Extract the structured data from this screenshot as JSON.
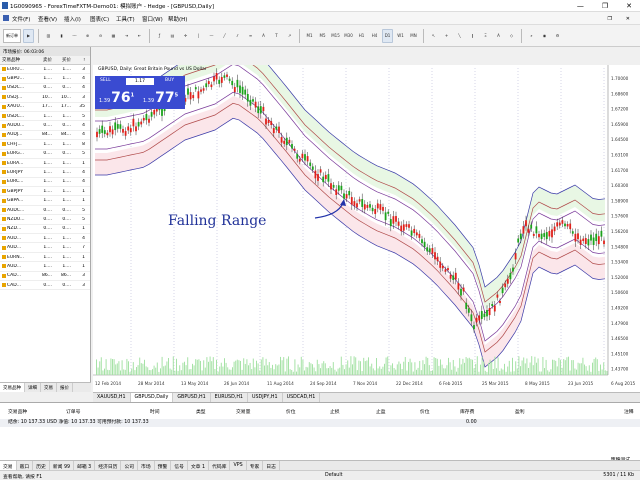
{
  "window": {
    "title": "1G0090965 - ForexTimeFXTM-Demo01: 模拟账户 - Hedge - [GBPUSD,Daily]",
    "controls": [
      "—",
      "❐",
      "✕"
    ]
  },
  "menu": [
    "文件(F)",
    "查看(V)",
    "插入(I)",
    "图表(C)",
    "工具(T)",
    "窗口(W)",
    "帮助(H)"
  ],
  "toolbar": {
    "new_order": "新订单",
    "timeframes": [
      "M1",
      "M5",
      "M15",
      "M30",
      "H1",
      "H4",
      "D1",
      "W1",
      "MN"
    ]
  },
  "market_watch": {
    "header": "市场报价: 06:03:06",
    "columns": [
      "交易品种",
      "卖价",
      "买价",
      "!"
    ],
    "rows": [
      {
        "symbol": "EURU...",
        "bid": "1....",
        "ask": "1....",
        "spread": "3"
      },
      {
        "symbol": "GBPU...",
        "bid": "1....",
        "ask": "1....",
        "spread": "4"
      },
      {
        "symbol": "USDC...",
        "bid": "0....",
        "ask": "0....",
        "spread": "4"
      },
      {
        "symbol": "USDJ...",
        "bid": "10...",
        "ask": "10...",
        "spread": "3"
      },
      {
        "symbol": "XAUU...",
        "bid": "17...",
        "ask": "17...",
        "spread": "35"
      },
      {
        "symbol": "USDC...",
        "bid": "1....",
        "ask": "1....",
        "spread": "5"
      },
      {
        "symbol": "AUDU...",
        "bid": "0....",
        "ask": "0....",
        "spread": "4"
      },
      {
        "symbol": "AUDJ...",
        "bid": "84...",
        "ask": "84...",
        "spread": "4"
      },
      {
        "symbol": "CHFJ...",
        "bid": "1....",
        "ask": "1....",
        "spread": "8"
      },
      {
        "symbol": "EURG...",
        "bid": "0....",
        "ask": "0....",
        "spread": "5"
      },
      {
        "symbol": "EURA...",
        "bid": "1....",
        "ask": "1....",
        "spread": "1"
      },
      {
        "symbol": "EURJPY",
        "bid": "1....",
        "ask": "1....",
        "spread": "4"
      },
      {
        "symbol": "EURC...",
        "bid": "1....",
        "ask": "1....",
        "spread": "4"
      },
      {
        "symbol": "GBPJPY",
        "bid": "1....",
        "ask": "1....",
        "spread": "1"
      },
      {
        "symbol": "GBPA...",
        "bid": "1....",
        "ask": "1....",
        "spread": "1"
      },
      {
        "symbol": "AUDC...",
        "bid": "0....",
        "ask": "0....",
        "spread": "5"
      },
      {
        "symbol": "NZDU...",
        "bid": "0....",
        "ask": "0....",
        "spread": "5"
      },
      {
        "symbol": "NZD...",
        "bid": "0....",
        "ask": "0....",
        "spread": "1"
      },
      {
        "symbol": "AUD...",
        "bid": "1....",
        "ask": "1....",
        "spread": "4"
      },
      {
        "symbol": "AUD...",
        "bid": "1....",
        "ask": "1....",
        "spread": "7"
      },
      {
        "symbol": "EURN...",
        "bid": "1....",
        "ask": "1....",
        "spread": "1"
      },
      {
        "symbol": "AUD...",
        "bid": "1....",
        "ask": "1....",
        "spread": "1"
      },
      {
        "symbol": "CAD...",
        "bid": "86...",
        "ask": "86...",
        "spread": "3"
      },
      {
        "symbol": "CAD...",
        "bid": "0....",
        "ask": "0....",
        "spread": "3"
      }
    ],
    "tabs": [
      "交易品种",
      "详细",
      "交易",
      "报价"
    ]
  },
  "chart": {
    "symbol_line": "GBPUSD, Daily: Great Britain Pound vs US Dollar",
    "one_click": {
      "sell": "SELL",
      "buy": "BUY",
      "volume": "1.17",
      "sell_price_small": "1.39",
      "sell_price_big": "76",
      "sell_sup": "1",
      "buy_price_small": "1.39",
      "buy_price_big": "77",
      "buy_sup": "5"
    },
    "annotation": "Falling Range",
    "price_labels": [
      "1.70000",
      "1.68600",
      "1.67200",
      "1.65900",
      "1.64500",
      "1.63100",
      "1.61700",
      "1.60300",
      "1.58900",
      "1.57600",
      "1.56200",
      "1.54800",
      "1.53400",
      "1.52000",
      "1.50600",
      "1.49200",
      "1.47900",
      "1.46500",
      "1.45100",
      "1.43700"
    ],
    "date_labels": [
      "12 Feb 2014",
      "28 Mar 2014",
      "13 May 2014",
      "26 Jun 2014",
      "11 Aug 2014",
      "24 Sep 2014",
      "7 Nov 2014",
      "22 Dec 2014",
      "6 Feb 2015",
      "25 Mar 2015",
      "8 May 2015",
      "23 Jun 2015",
      "6 Aug 2015"
    ]
  },
  "chart_tabs": [
    "XAUUSD,H1",
    "GBPUSD,Daily",
    "GBPUSD,H1",
    "EURUSD,H1",
    "USDJPY,H1",
    "USDCAD,H1"
  ],
  "terminal": {
    "columns": [
      "交易品种",
      "订单号",
      "时间",
      "类型",
      "交易量",
      "价位",
      "止损",
      "止盈",
      "价位",
      "库存费",
      "盈利",
      "注释"
    ],
    "balance_line": "结余: 10 137.33 USD  净值: 10 137.33  可用预付款: 10 137.33",
    "profit": "0.00",
    "tabs": [
      "交易",
      "敞口",
      "历史",
      "新闻 99",
      "邮箱 3",
      "经济日历",
      "公司",
      "市场",
      "预警",
      "信号",
      "文章 1",
      "代码库",
      "VPS",
      "专家",
      "日志"
    ],
    "signal": "策略测试"
  },
  "status": {
    "left": "查看帮助, 请按 F1",
    "mid": "Default",
    "right": "5301 / 11 Kb"
  }
}
